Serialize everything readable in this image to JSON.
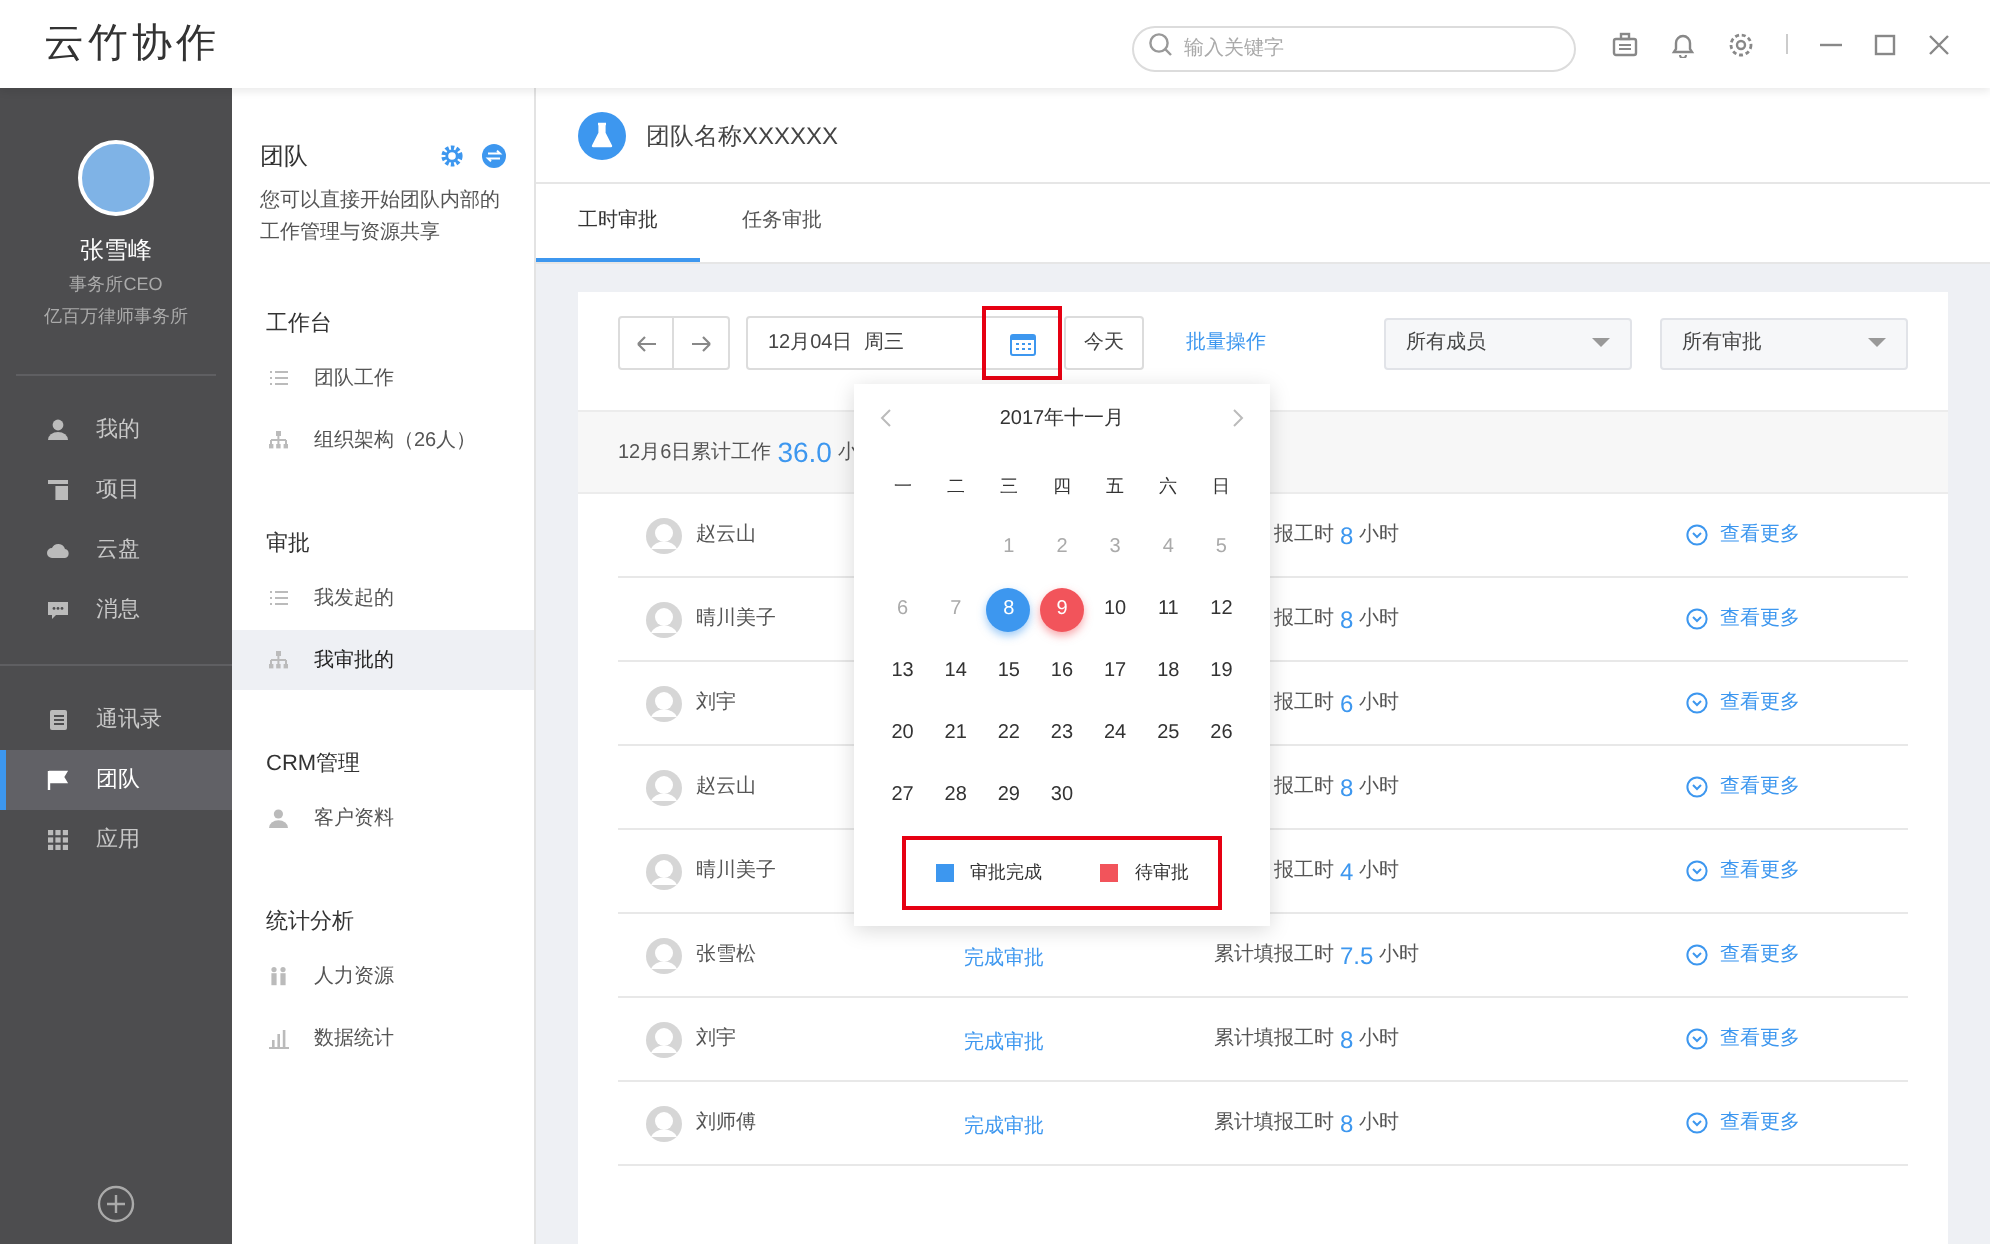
{
  "app": {
    "title": "云竹协作"
  },
  "search": {
    "placeholder": "输入关键字"
  },
  "profile": {
    "name": "张雪峰",
    "role": "事务所CEO",
    "company": "亿百万律师事务所"
  },
  "nav_groups": [
    [
      {
        "label": "我的",
        "selected": false
      },
      {
        "label": "项目",
        "selected": false
      },
      {
        "label": "云盘",
        "selected": false
      },
      {
        "label": "消息",
        "selected": false
      }
    ],
    [
      {
        "label": "通讯录",
        "selected": false
      },
      {
        "label": "团队",
        "selected": true
      },
      {
        "label": "应用",
        "selected": false
      }
    ]
  ],
  "team_panel": {
    "title": "团队",
    "description": "您可以直接开始团队内部的工作管理与资源共享",
    "sections": [
      {
        "title": "工作台",
        "items": [
          {
            "label": "团队工作",
            "selected": false
          },
          {
            "label": "组织架构（26人）",
            "selected": false
          }
        ]
      },
      {
        "title": "审批",
        "items": [
          {
            "label": "我发起的",
            "selected": false
          },
          {
            "label": "我审批的",
            "selected": true
          }
        ]
      },
      {
        "title": "CRM管理",
        "items": [
          {
            "label": "客户资料",
            "selected": false
          }
        ]
      },
      {
        "title": "统计分析",
        "items": [
          {
            "label": "人力资源",
            "selected": false
          },
          {
            "label": "数据统计",
            "selected": false
          }
        ]
      }
    ]
  },
  "team_header": {
    "name": "团队名称XXXXXX"
  },
  "tabs": [
    {
      "label": "工时审批",
      "selected": true
    },
    {
      "label": "任务审批",
      "selected": false
    }
  ],
  "toolbar": {
    "date": "12月04日  周三",
    "today": "今天",
    "batch": "批量操作",
    "filters": [
      "所有成员",
      "所有审批"
    ]
  },
  "summary": {
    "label": "12月6日累计工作",
    "value": "36.0",
    "unit": "小"
  },
  "rows": [
    {
      "name": "赵云山",
      "hours_label": "报工时",
      "hours": "8",
      "unit": "小时",
      "more": "查看更多"
    },
    {
      "name": "晴川美子",
      "hours_label": "报工时",
      "hours": "8",
      "unit": "小时",
      "more": "查看更多"
    },
    {
      "name": "刘宇",
      "hours_label": "报工时",
      "hours": "6",
      "unit": "小时",
      "more": "查看更多"
    },
    {
      "name": "赵云山",
      "hours_label": "报工时",
      "hours": "8",
      "unit": "小时",
      "more": "查看更多"
    },
    {
      "name": "晴川美子",
      "hours_label": "报工时",
      "hours": "4",
      "unit": "小时",
      "more": "查看更多"
    },
    {
      "name": "张雪松",
      "status": "完成审批",
      "hours_label": "累计填报工时",
      "hours": "7.5",
      "unit": "小时",
      "more": "查看更多"
    },
    {
      "name": "刘宇",
      "status": "完成审批",
      "hours_label": "累计填报工时",
      "hours": "8",
      "unit": "小时",
      "more": "查看更多"
    },
    {
      "name": "刘师傅",
      "status": "完成审批",
      "hours_label": "累计填报工时",
      "hours": "8",
      "unit": "小时",
      "more": "查看更多"
    }
  ],
  "calendar": {
    "title": "2017年十一月",
    "weekdays": [
      "一",
      "二",
      "三",
      "四",
      "五",
      "六",
      "日"
    ],
    "weeks": [
      [
        {
          "kind": "blank"
        },
        {
          "kind": "blank"
        },
        {
          "day": "1",
          "kind": "muted"
        },
        {
          "day": "2",
          "kind": "muted"
        },
        {
          "day": "3",
          "kind": "muted"
        },
        {
          "day": "4",
          "kind": "muted"
        },
        {
          "day": "5",
          "kind": "muted"
        }
      ],
      [
        {
          "day": "6",
          "kind": "muted"
        },
        {
          "day": "7",
          "kind": "muted"
        },
        {
          "day": "8",
          "kind": "approved"
        },
        {
          "day": "9",
          "kind": "pending"
        },
        {
          "day": "10",
          "kind": "normal"
        },
        {
          "day": "11",
          "kind": "normal"
        },
        {
          "day": "12",
          "kind": "normal"
        }
      ],
      [
        {
          "day": "13",
          "kind": "normal"
        },
        {
          "day": "14",
          "kind": "normal"
        },
        {
          "day": "15",
          "kind": "normal"
        },
        {
          "day": "16",
          "kind": "normal"
        },
        {
          "day": "17",
          "kind": "normal"
        },
        {
          "day": "18",
          "kind": "normal"
        },
        {
          "day": "19",
          "kind": "normal"
        }
      ],
      [
        {
          "day": "20",
          "kind": "normal"
        },
        {
          "day": "21",
          "kind": "normal"
        },
        {
          "day": "22",
          "kind": "normal"
        },
        {
          "day": "23",
          "kind": "normal"
        },
        {
          "day": "24",
          "kind": "normal"
        },
        {
          "day": "25",
          "kind": "normal"
        },
        {
          "day": "26",
          "kind": "normal"
        }
      ],
      [
        {
          "day": "27",
          "kind": "normal"
        },
        {
          "day": "28",
          "kind": "normal"
        },
        {
          "day": "29",
          "kind": "normal"
        },
        {
          "day": "30",
          "kind": "normal"
        },
        {
          "kind": "blank"
        },
        {
          "kind": "blank"
        },
        {
          "kind": "blank"
        }
      ]
    ],
    "legend": [
      {
        "label": "审批完成",
        "color": "#3d97ef"
      },
      {
        "label": "待审批",
        "color": "#f2545b"
      }
    ]
  }
}
